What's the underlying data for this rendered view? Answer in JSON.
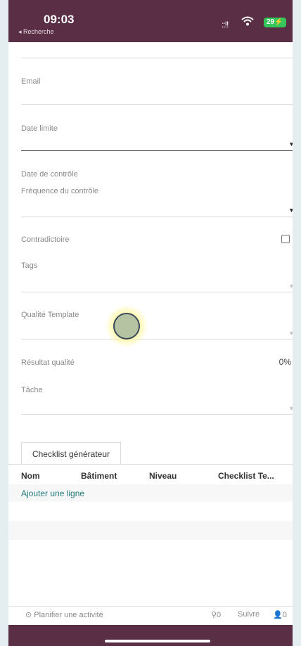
{
  "status_bar": {
    "time": "09:03",
    "back_label": "◂ Recherche",
    "signal": "::!!",
    "battery": "29⚡"
  },
  "form": {
    "email_label": "Email",
    "date_limite_label": "Date limite",
    "date_controle_label": "Date de contrôle",
    "frequence_label": "Fréquence du contrôle",
    "contradictoire_label": "Contradictoire",
    "tags_label": "Tags",
    "qualite_template_label": "Qualité Template",
    "resultat_label": "Résultat qualité",
    "resultat_value": "0%",
    "tache_label": "Tâche"
  },
  "tabs": {
    "checklist_label": "Checklist générateur"
  },
  "table": {
    "headers": [
      "Nom",
      "Bâtiment",
      "Niveau",
      "Checklist Te..."
    ],
    "add_line": "Ajouter une ligne"
  },
  "footer": {
    "plan_activity": "⊙ Planifier une activité",
    "attachments": "⚲0",
    "follow": "Suivre",
    "followers": "👤0"
  },
  "colors": {
    "brand": "#5a2e44",
    "link": "#1f7a7a"
  }
}
